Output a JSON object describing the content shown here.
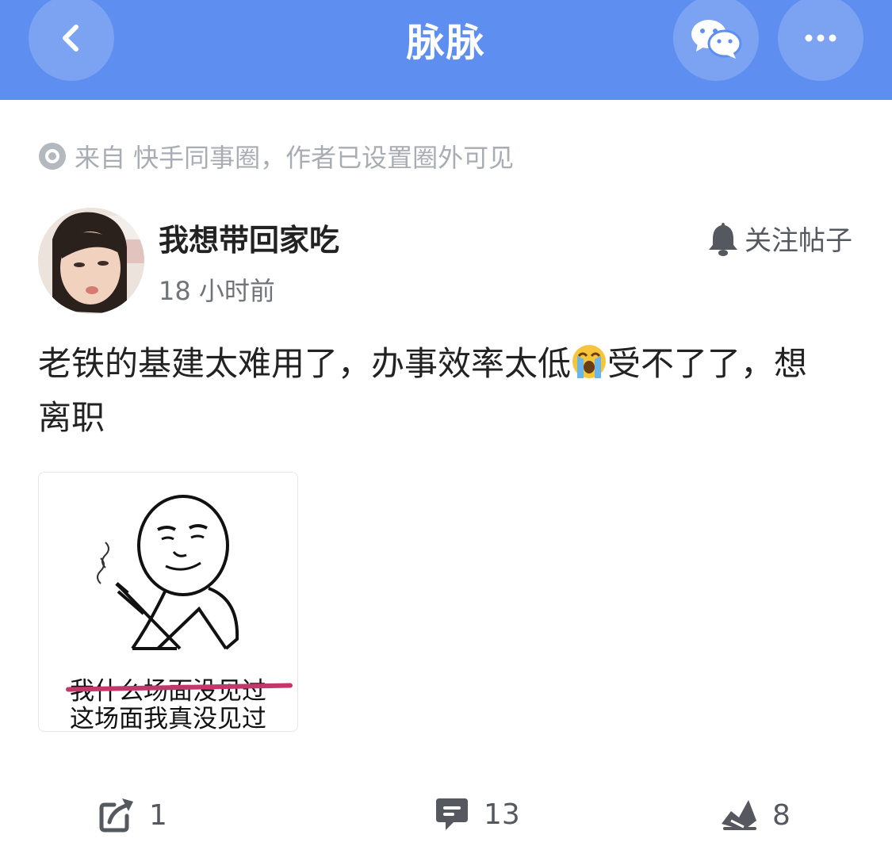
{
  "header": {
    "title": "脉脉",
    "back_icon": "chevron-left-icon",
    "wechat_icon": "wechat-icon",
    "more_icon": "more-icon",
    "bg_color": "#5e8ff0"
  },
  "post": {
    "source": "来自 快手同事圈，作者已设置圈外可见",
    "author": "我想带回家吃",
    "time": "18 小时前",
    "follow_label": "关注帖子",
    "content_part1": "老铁的基建太难用了，办事效率太低",
    "content_part2": "受不了了，想离职",
    "image": {
      "caption_struck": "我什么场面没见过",
      "caption": "这场面我真没见过"
    }
  },
  "actions": {
    "share_count": "1",
    "comment_count": "13",
    "like_count": "8"
  }
}
